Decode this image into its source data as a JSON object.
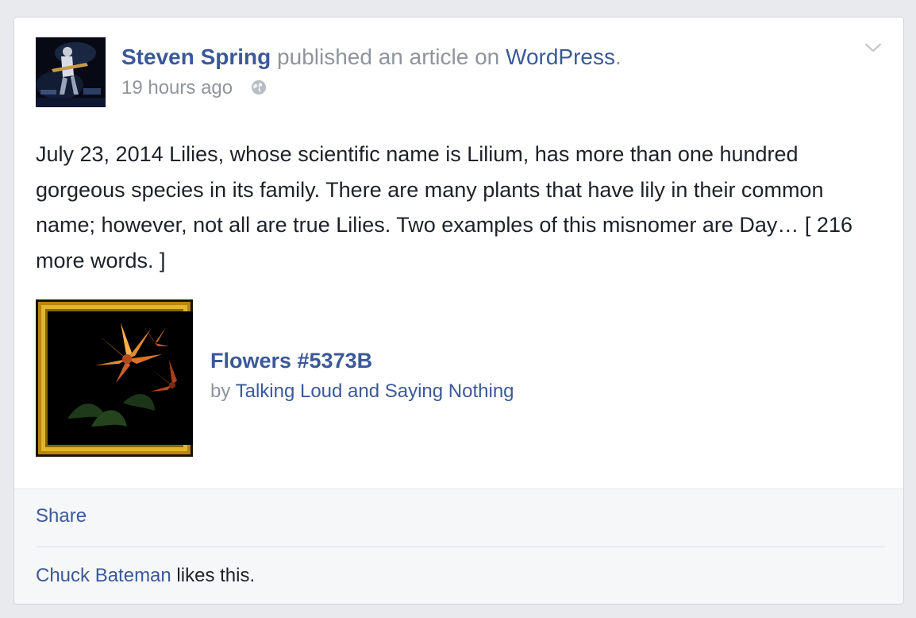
{
  "post": {
    "author": "Steven Spring",
    "action": " published an article on ",
    "platform": "WordPress",
    "period": ".",
    "timestamp": "19 hours ago",
    "privacy_icon": "globe-icon",
    "menu_icon": "chevron-down-icon",
    "body": "July 23, 2014 Lilies, whose scientific name is Lilium, has more than one hundred gorgeous species in its family. There are many plants that have lily in their common name; however, not all are true Lilies. Two examples of this misnomer are Day… [ 216 more words. ]"
  },
  "attachment": {
    "title": "Flowers #5373B",
    "by_prefix": "by ",
    "source": "Talking Loud and Saying Nothing"
  },
  "footer": {
    "share_label": "Share",
    "liker": "Chuck Bateman",
    "likes_suffix": " likes this."
  },
  "colors": {
    "link": "#3b5998",
    "muted": "#90949c",
    "text": "#1d2129",
    "background": "#e9eaed",
    "footer_bg": "#f6f7f9"
  }
}
